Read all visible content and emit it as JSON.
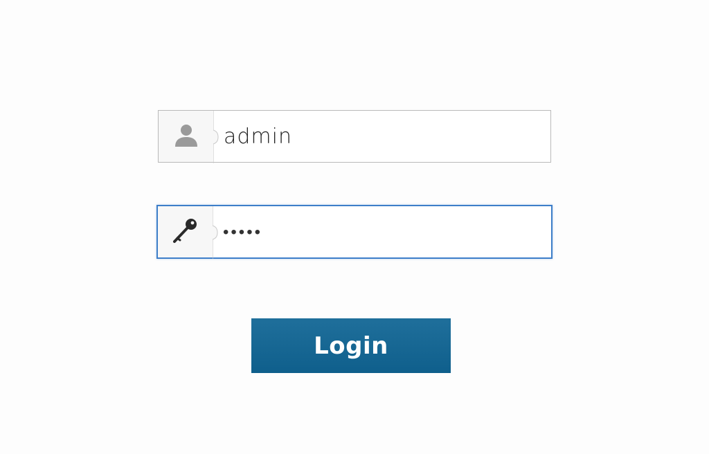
{
  "form": {
    "username": {
      "value": "admin",
      "icon": "user-icon"
    },
    "password": {
      "value": "•••••",
      "icon": "key-icon"
    },
    "login_label": "Login"
  },
  "colors": {
    "button": "#146791",
    "focus_border": "#3d7ec9",
    "icon_bg": "#f7f7f7"
  }
}
